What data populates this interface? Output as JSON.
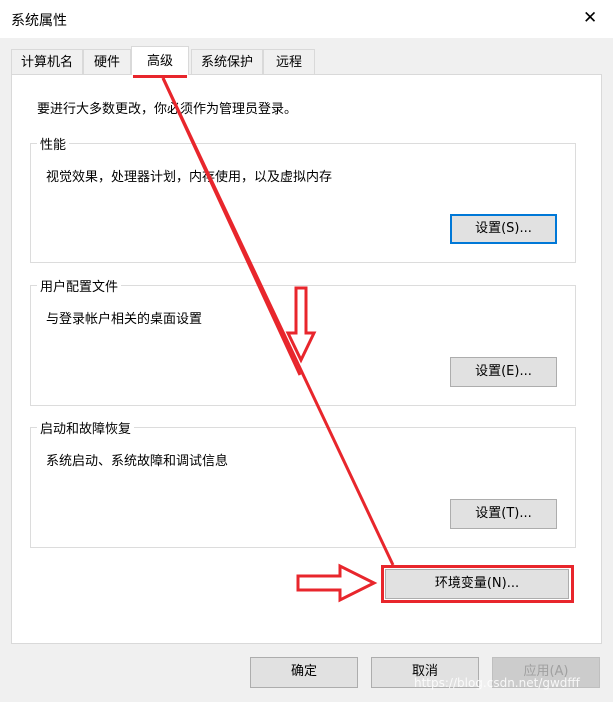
{
  "window": {
    "title": "系统属性"
  },
  "tabs": [
    {
      "label": "计算机名"
    },
    {
      "label": "硬件"
    },
    {
      "label": "高级",
      "active": true
    },
    {
      "label": "系统保护"
    },
    {
      "label": "远程"
    }
  ],
  "admin_note": "要进行大多数更改，你必须作为管理员登录。",
  "performance": {
    "title": "性能",
    "description": "视觉效果，处理器计划，内存使用，以及虚拟内存",
    "button": "设置(S)..."
  },
  "user_profiles": {
    "title": "用户配置文件",
    "description": "与登录帐户相关的桌面设置",
    "button": "设置(E)..."
  },
  "startup_recovery": {
    "title": "启动和故障恢复",
    "description": "系统启动、系统故障和调试信息",
    "button": "设置(T)..."
  },
  "env_button": "环境变量(N)...",
  "footer": {
    "ok": "确定",
    "cancel": "取消",
    "apply": "应用(A)"
  },
  "watermark": "https://blog.csdn.net/gwdfff",
  "colors": {
    "annotation": "#e8262c",
    "focus": "#0078d7"
  }
}
